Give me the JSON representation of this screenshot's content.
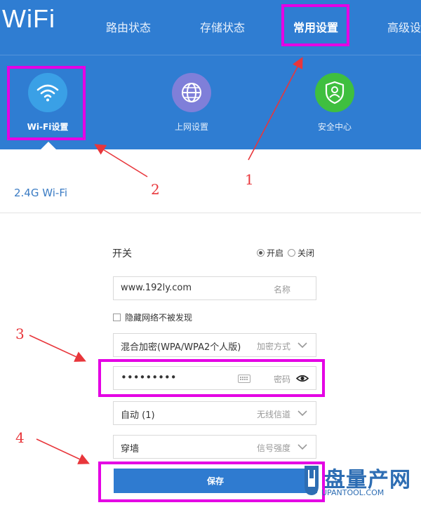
{
  "header": {
    "logo_text": "iWiFi",
    "nav": [
      {
        "label": "路由状态"
      },
      {
        "label": "存储状态"
      },
      {
        "label": "常用设置"
      },
      {
        "label": "高级设"
      }
    ],
    "active_nav": "常用设置",
    "sub_nav": [
      {
        "label": "Wi-Fi设置",
        "icon": "wifi-icon",
        "color": "#3aa0e6"
      },
      {
        "label": "上网设置",
        "icon": "globe-icon",
        "color": "#7f7fd9"
      },
      {
        "label": "安全中心",
        "icon": "shield-icon",
        "color": "#3fbf3f"
      }
    ]
  },
  "section": {
    "title": "2.4G Wi-Fi"
  },
  "form": {
    "switch_label": "开关",
    "switch_on": "开启",
    "switch_off": "关闭",
    "switch_state": "开启",
    "ssid_value": "www.192ly.com",
    "ssid_hint": "名称",
    "hide_network_label": "隐藏网络不被发现",
    "hide_network_checked": false,
    "encryption_value": "混合加密(WPA/WPA2个人版)",
    "encryption_hint": "加密方式",
    "password_value": "•••••••••",
    "password_hint": "密码",
    "channel_value": "自动 (1)",
    "channel_hint": "无线信道",
    "strength_value": "穿墙",
    "strength_hint": "信号强度",
    "save_label": "保存"
  },
  "annotations": {
    "n1": "1",
    "n2": "2",
    "n3": "3",
    "n4": "4",
    "highlight_color": "#e400e4",
    "arrow_color": "#e8363b"
  },
  "watermark": {
    "brand": "盘量产网",
    "url": "UPANTOOL.COM"
  },
  "colors": {
    "header_bg": "#2f7dd2",
    "accent": "#3b7cc4",
    "button": "#2f7bd0"
  }
}
